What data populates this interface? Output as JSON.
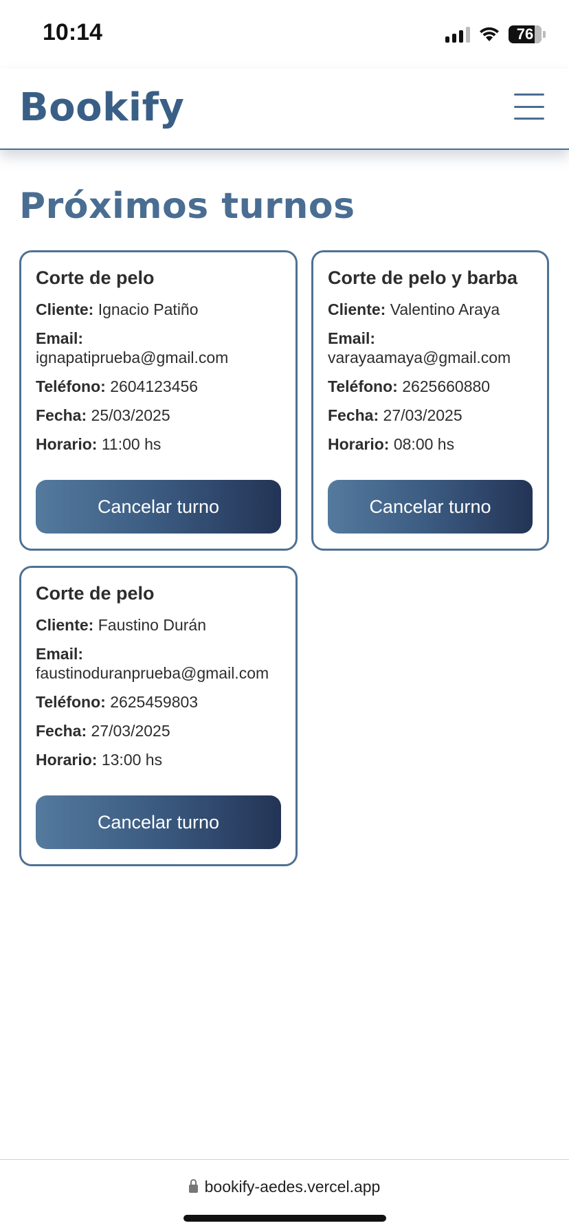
{
  "status_bar": {
    "time": "10:14",
    "battery": "76"
  },
  "header": {
    "logo": "Bookify"
  },
  "page": {
    "title": "Próximos turnos"
  },
  "labels": {
    "cliente": "Cliente:",
    "email": "Email:",
    "telefono": "Teléfono:",
    "fecha": "Fecha:",
    "horario": "Horario:",
    "cancel": "Cancelar turno"
  },
  "appointments": [
    {
      "service": "Corte de pelo",
      "cliente": "Ignacio Patiño",
      "email": "ignapatiprueba@gmail.com",
      "telefono": "2604123456",
      "fecha": "25/03/2025",
      "horario": "11:00 hs"
    },
    {
      "service": "Corte de pelo y barba",
      "cliente": "Valentino Araya",
      "email": "varayaamaya@gmail.com",
      "telefono": "2625660880",
      "fecha": "27/03/2025",
      "horario": "08:00 hs"
    },
    {
      "service": "Corte de pelo",
      "cliente": "Faustino Durán",
      "email": "faustinoduranprueba@gmail.com",
      "telefono": "2625459803",
      "fecha": "27/03/2025",
      "horario": "13:00 hs"
    }
  ],
  "browser": {
    "url": "bookify-aedes.vercel.app"
  },
  "colors": {
    "brand": "#4a6d92",
    "button_start": "#547a9e",
    "button_end": "#233456"
  }
}
